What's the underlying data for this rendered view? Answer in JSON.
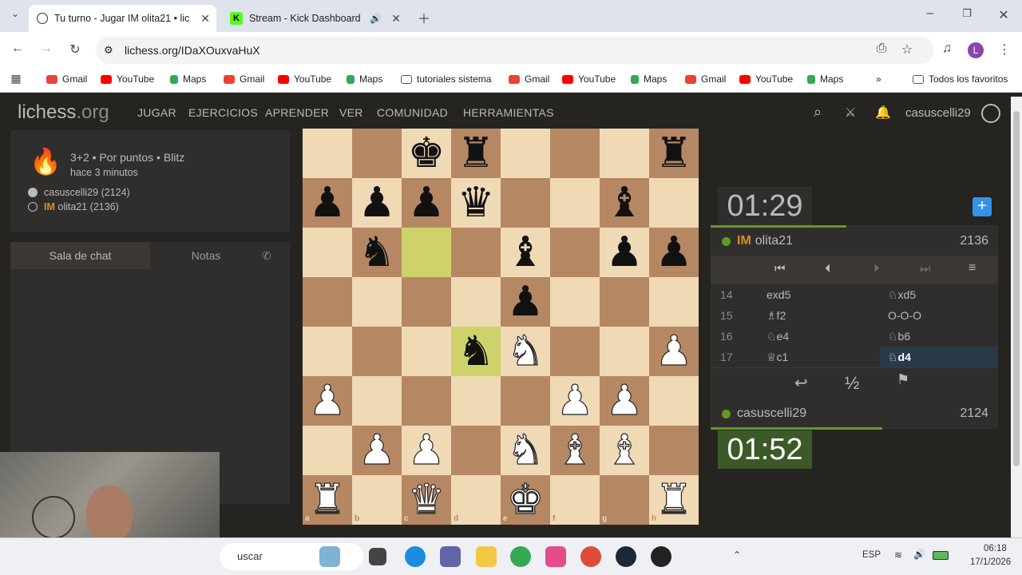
{
  "browser": {
    "tabs": [
      {
        "title": "Tu turno - Jugar IM olita21 • lic"
      },
      {
        "title": "Stream - Kick Dashboard"
      }
    ],
    "url": "lichess.org/IDaXOuxvaHuX",
    "profile_initial": "L",
    "bookmarks": [
      "Gmail",
      "YouTube",
      "Maps",
      "Gmail",
      "YouTube",
      "Maps",
      "tutoriales sistema",
      "Gmail",
      "YouTube",
      "Maps",
      "Gmail",
      "YouTube",
      "Maps"
    ],
    "all_favorites": "Todos los favoritos"
  },
  "site": {
    "logo_main": "lichess",
    "logo_tld": ".org",
    "nav": [
      "JUGAR",
      "EJERCICIOS",
      "APRENDER",
      "VER",
      "COMUNIDAD",
      "HERRAMIENTAS"
    ],
    "username": "casuscelli29"
  },
  "game": {
    "type": "3+2 • Por puntos • Blitz",
    "time_ago": "hace 3 minutos",
    "white": "casuscelli29 (2124)",
    "black_title": "IM",
    "black": "olita21 (2136)"
  },
  "chat": {
    "tab_chat": "Sala de chat",
    "tab_notes": "Notas"
  },
  "board": {
    "files": [
      "a",
      "b",
      "c",
      "d",
      "e",
      "f",
      "g",
      "h"
    ],
    "ranks": [
      "8",
      "7",
      "6",
      "5",
      "4",
      "3",
      "2",
      "1"
    ]
  },
  "opponent": {
    "title": "IM",
    "name": "olita21",
    "rating": "2136",
    "clock": "01:29"
  },
  "player": {
    "name": "casuscelli29",
    "rating": "2124",
    "clock": "01:52"
  },
  "moves": [
    {
      "n": "14",
      "w": "exd5",
      "b": "♘xd5"
    },
    {
      "n": "15",
      "w": "♗f2",
      "b": "O-O-O"
    },
    {
      "n": "16",
      "w": "♘e4",
      "b": "♘b6"
    },
    {
      "n": "17",
      "w": "♕c1",
      "b": "♘d4"
    }
  ],
  "controls": {
    "draw": "½"
  },
  "taskbar": {
    "search": "uscar",
    "lang": "ESP",
    "time": "06:18",
    "date": "17/1/2026"
  },
  "colors": {
    "accent_green": "#629924",
    "board_light": "#f0d9b5",
    "board_dark": "#b58863",
    "highlight": "#cdd26a"
  }
}
